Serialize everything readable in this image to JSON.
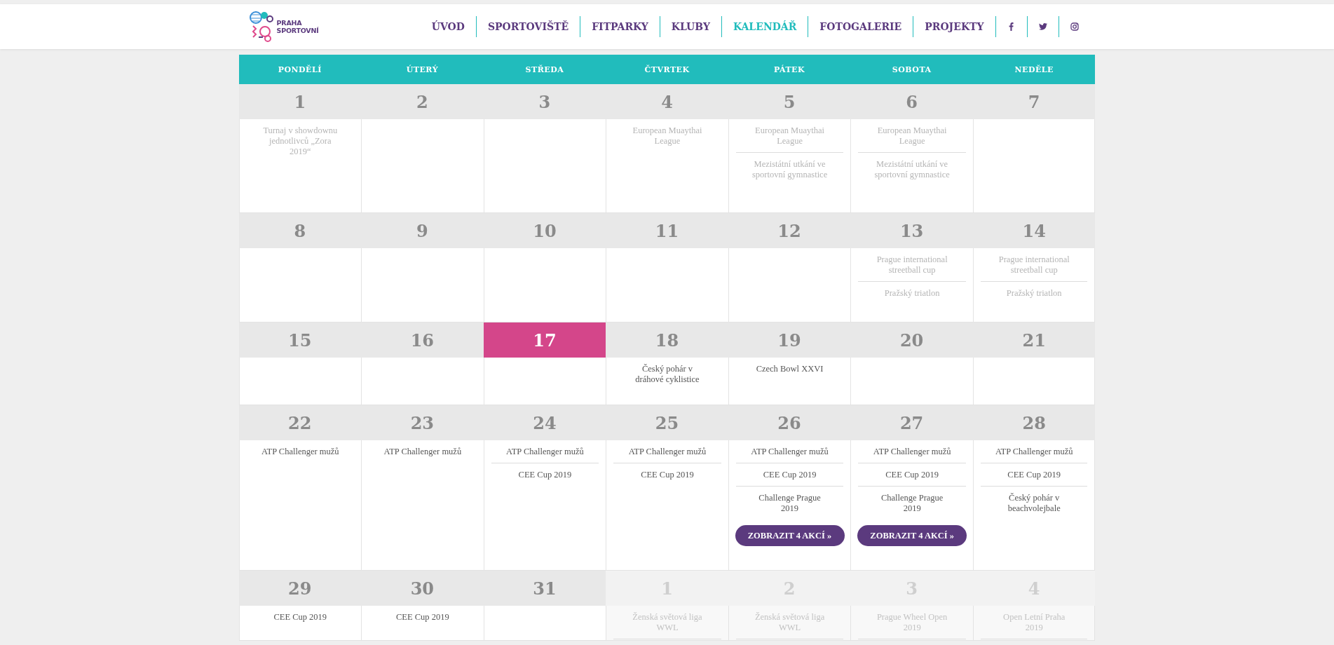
{
  "logo": {
    "lines": [
      "PRAHA",
      "SPORTOVNÍ"
    ]
  },
  "nav": [
    {
      "label": "ÚVOD",
      "selected": false
    },
    {
      "label": "SPORTOVIŠTĚ",
      "selected": false
    },
    {
      "label": "FITPARKY",
      "selected": false
    },
    {
      "label": "KLUBY",
      "selected": false
    },
    {
      "label": "KALENDÁŘ",
      "selected": true
    },
    {
      "label": "FOTOGALERIE",
      "selected": false
    },
    {
      "label": "PROJEKTY",
      "selected": false
    }
  ],
  "social": [
    {
      "kind": "facebook"
    },
    {
      "kind": "twitter"
    },
    {
      "kind": "instagram"
    }
  ],
  "weekdays": [
    "PONDĚLÍ",
    "ÚTERÝ",
    "STŘEDA",
    "ČTVRTEK",
    "PÁTEK",
    "SOBOTA",
    "NEDĚLE"
  ],
  "weeks": [
    {
      "days": [
        {
          "day": "1",
          "today": false,
          "next_month": false,
          "events": [
            {
              "title": "Turnaj v showdownu jednotlivců „Zora 2019“",
              "past": true
            }
          ]
        },
        {
          "day": "2",
          "today": false,
          "next_month": false
        },
        {
          "day": "3",
          "today": false,
          "next_month": false
        },
        {
          "day": "4",
          "today": false,
          "next_month": false,
          "events": [
            {
              "title": "European Muaythai League",
              "past": true
            }
          ]
        },
        {
          "day": "5",
          "today": false,
          "next_month": false,
          "events": [
            {
              "title": "European Muaythai League",
              "past": true
            },
            {
              "title": "Mezistátní utkání ve sportovní gymnastice",
              "past": true
            }
          ]
        },
        {
          "day": "6",
          "today": false,
          "next_month": false,
          "events": [
            {
              "title": "European Muaythai League",
              "past": true
            },
            {
              "title": "Mezistátní utkání ve sportovní gymnastice",
              "past": true
            }
          ]
        },
        {
          "day": "7",
          "today": false,
          "next_month": false
        }
      ]
    },
    {
      "days": [
        {
          "day": "8",
          "today": false,
          "next_month": false
        },
        {
          "day": "9",
          "today": false,
          "next_month": false
        },
        {
          "day": "10",
          "today": false,
          "next_month": false
        },
        {
          "day": "11",
          "today": false,
          "next_month": false
        },
        {
          "day": "12",
          "today": false,
          "next_month": false
        },
        {
          "day": "13",
          "today": false,
          "next_month": false,
          "events": [
            {
              "title": "Prague international streetball cup",
              "past": true
            },
            {
              "title": "Pražský triatlon",
              "past": true
            }
          ]
        },
        {
          "day": "14",
          "today": false,
          "next_month": false,
          "events": [
            {
              "title": "Prague international streetball cup",
              "past": true
            },
            {
              "title": "Pražský triatlon",
              "past": true
            }
          ]
        }
      ]
    },
    {
      "days": [
        {
          "day": "15",
          "today": false,
          "next_month": false
        },
        {
          "day": "16",
          "today": false,
          "next_month": false
        },
        {
          "day": "17",
          "today": true,
          "next_month": false
        },
        {
          "day": "18",
          "today": false,
          "next_month": false,
          "events": [
            {
              "title": "Český pohár v dráhové cyklistice",
              "past": false
            }
          ]
        },
        {
          "day": "19",
          "today": false,
          "next_month": false,
          "events": [
            {
              "title": "Czech Bowl XXVI",
              "past": false
            }
          ]
        },
        {
          "day": "20",
          "today": false,
          "next_month": false
        },
        {
          "day": "21",
          "today": false,
          "next_month": false
        }
      ]
    },
    {
      "days": [
        {
          "day": "22",
          "today": false,
          "next_month": false,
          "events": [
            {
              "title": "ATP Challenger mužů",
              "past": false
            }
          ]
        },
        {
          "day": "23",
          "today": false,
          "next_month": false,
          "events": [
            {
              "title": "ATP Challenger mužů",
              "past": false
            }
          ]
        },
        {
          "day": "24",
          "today": false,
          "next_month": false,
          "events": [
            {
              "title": "ATP Challenger mužů",
              "past": false
            },
            {
              "title": "CEE Cup 2019",
              "past": false
            }
          ]
        },
        {
          "day": "25",
          "today": false,
          "next_month": false,
          "events": [
            {
              "title": "ATP Challenger mužů",
              "past": false
            },
            {
              "title": "CEE Cup 2019",
              "past": false
            }
          ]
        },
        {
          "day": "26",
          "today": false,
          "next_month": false,
          "events": [
            {
              "title": "ATP Challenger mužů",
              "past": false
            },
            {
              "title": "CEE Cup 2019",
              "past": false
            },
            {
              "title": "Challenge Prague 2019",
              "past": false
            }
          ],
          "more": "ZOBRAZIT 4 AKCÍ »"
        },
        {
          "day": "27",
          "today": false,
          "next_month": false,
          "events": [
            {
              "title": "ATP Challenger mužů",
              "past": false
            },
            {
              "title": "CEE Cup 2019",
              "past": false
            },
            {
              "title": "Challenge Prague 2019",
              "past": false
            }
          ],
          "more": "ZOBRAZIT 4 AKCÍ »"
        },
        {
          "day": "28",
          "today": false,
          "next_month": false,
          "events": [
            {
              "title": "ATP Challenger mužů",
              "past": false
            },
            {
              "title": "CEE Cup 2019",
              "past": false
            },
            {
              "title": "Český pohár v beachvolejbale",
              "past": false
            }
          ]
        }
      ]
    },
    {
      "days": [
        {
          "day": "29",
          "today": false,
          "next_month": false,
          "events": [
            {
              "title": "CEE Cup 2019",
              "past": false
            }
          ]
        },
        {
          "day": "30",
          "today": false,
          "next_month": false,
          "events": [
            {
              "title": "CEE Cup 2019",
              "past": false
            }
          ]
        },
        {
          "day": "31",
          "today": false,
          "next_month": false
        },
        {
          "day": "1",
          "today": false,
          "next_month": true,
          "events": [
            {
              "title": "Ženská světová liga WWL",
              "past": false
            }
          ]
        },
        {
          "day": "2",
          "today": false,
          "next_month": true,
          "events": [
            {
              "title": "Ženská světová liga WWL",
              "past": false
            }
          ]
        },
        {
          "day": "3",
          "today": false,
          "next_month": true,
          "events": [
            {
              "title": "Prague Wheel Open 2019",
              "past": false
            }
          ]
        },
        {
          "day": "4",
          "today": false,
          "next_month": true,
          "events": [
            {
              "title": "Open Letní Praha 2019",
              "past": false
            }
          ]
        }
      ]
    }
  ]
}
